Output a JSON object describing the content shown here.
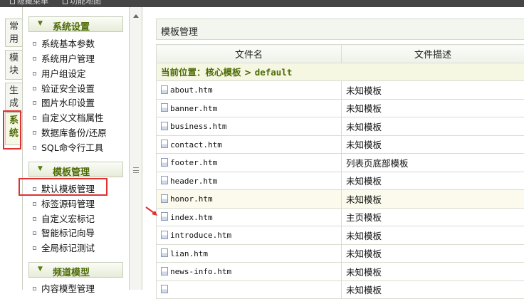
{
  "topbar": {
    "items": [
      "隐藏菜单",
      "功能地图"
    ]
  },
  "tabs": [
    {
      "label": "常用",
      "active": false
    },
    {
      "label": "模块",
      "active": false
    },
    {
      "label": "生成",
      "active": false
    },
    {
      "label": "系统",
      "active": true
    }
  ],
  "menu": {
    "sections": [
      {
        "title": "系统设置",
        "items": [
          "系统基本参数",
          "系统用户管理",
          "用户组设定",
          "验证安全设置",
          "图片水印设置",
          "自定义文档属性",
          "数据库备份/还原",
          "SQL命令行工具"
        ]
      },
      {
        "title": "模板管理",
        "items": [
          "默认模板管理",
          "标签源码管理",
          "自定义宏标记",
          "智能标记向导",
          "全局标记测试"
        ]
      },
      {
        "title": "频道模型",
        "items": [
          "内容模型管理"
        ]
      }
    ]
  },
  "content": {
    "panel_title": "模板管理",
    "columns": [
      "文件名",
      "文件描述"
    ],
    "location_label": "当前位置：核心模板 >",
    "location_path": "default",
    "rows": [
      {
        "file": "about.htm",
        "desc": "未知模板"
      },
      {
        "file": "banner.htm",
        "desc": "未知模板"
      },
      {
        "file": "business.htm",
        "desc": "未知模板"
      },
      {
        "file": "contact.htm",
        "desc": "未知模板"
      },
      {
        "file": "footer.htm",
        "desc": "列表页底部模板"
      },
      {
        "file": "header.htm",
        "desc": "未知模板"
      },
      {
        "file": "honor.htm",
        "desc": "未知模板"
      },
      {
        "file": "index.htm",
        "desc": "主页模板"
      },
      {
        "file": "introduce.htm",
        "desc": "未知模板"
      },
      {
        "file": "lian.htm",
        "desc": "未知模板"
      },
      {
        "file": "news-info.htm",
        "desc": "未知模板"
      },
      {
        "file": "",
        "desc": "未知模板"
      }
    ]
  },
  "colors": {
    "accent_green": "#4d6b06",
    "annotation_red": "#e03030",
    "topbar": "#454545"
  }
}
